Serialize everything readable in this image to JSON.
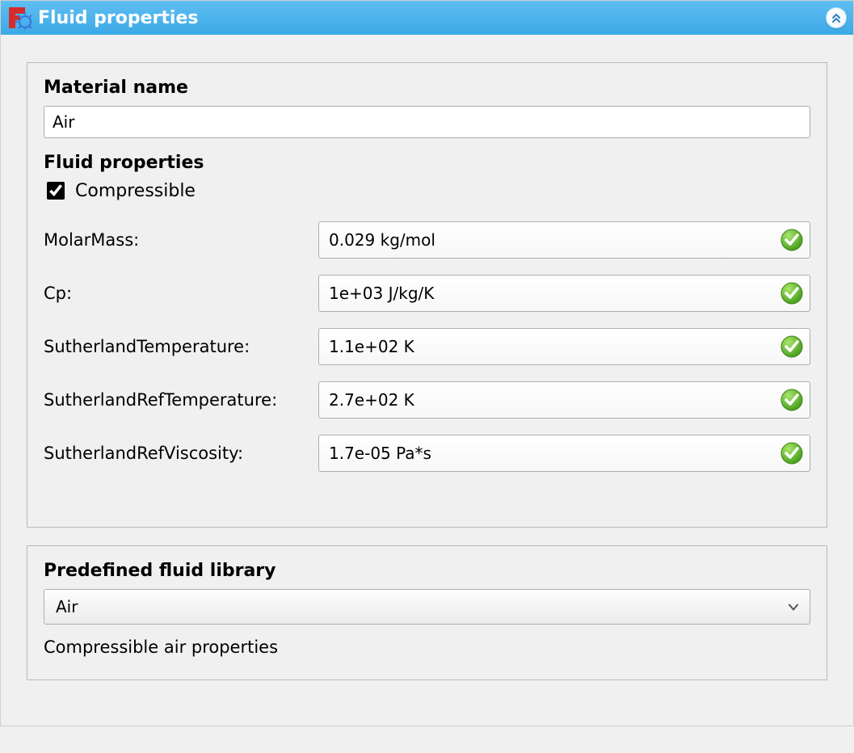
{
  "header": {
    "title": "Fluid properties"
  },
  "material": {
    "name_label": "Material name",
    "name_value": "Air",
    "fluid_props_heading": "Fluid properties",
    "compressible_label": "Compressible",
    "compressible_checked": true,
    "props": [
      {
        "label": "MolarMass:",
        "value": "0.029 kg/mol"
      },
      {
        "label": "Cp:",
        "value": "1e+03 J/kg/K"
      },
      {
        "label": "SutherlandTemperature:",
        "value": "1.1e+02 K"
      },
      {
        "label": "SutherlandRefTemperature:",
        "value": "2.7e+02 K"
      },
      {
        "label": "SutherlandRefViscosity:",
        "value": "1.7e-05 Pa*s"
      }
    ]
  },
  "library": {
    "heading": "Predefined fluid library",
    "selected": "Air",
    "description": "Compressible air properties"
  }
}
